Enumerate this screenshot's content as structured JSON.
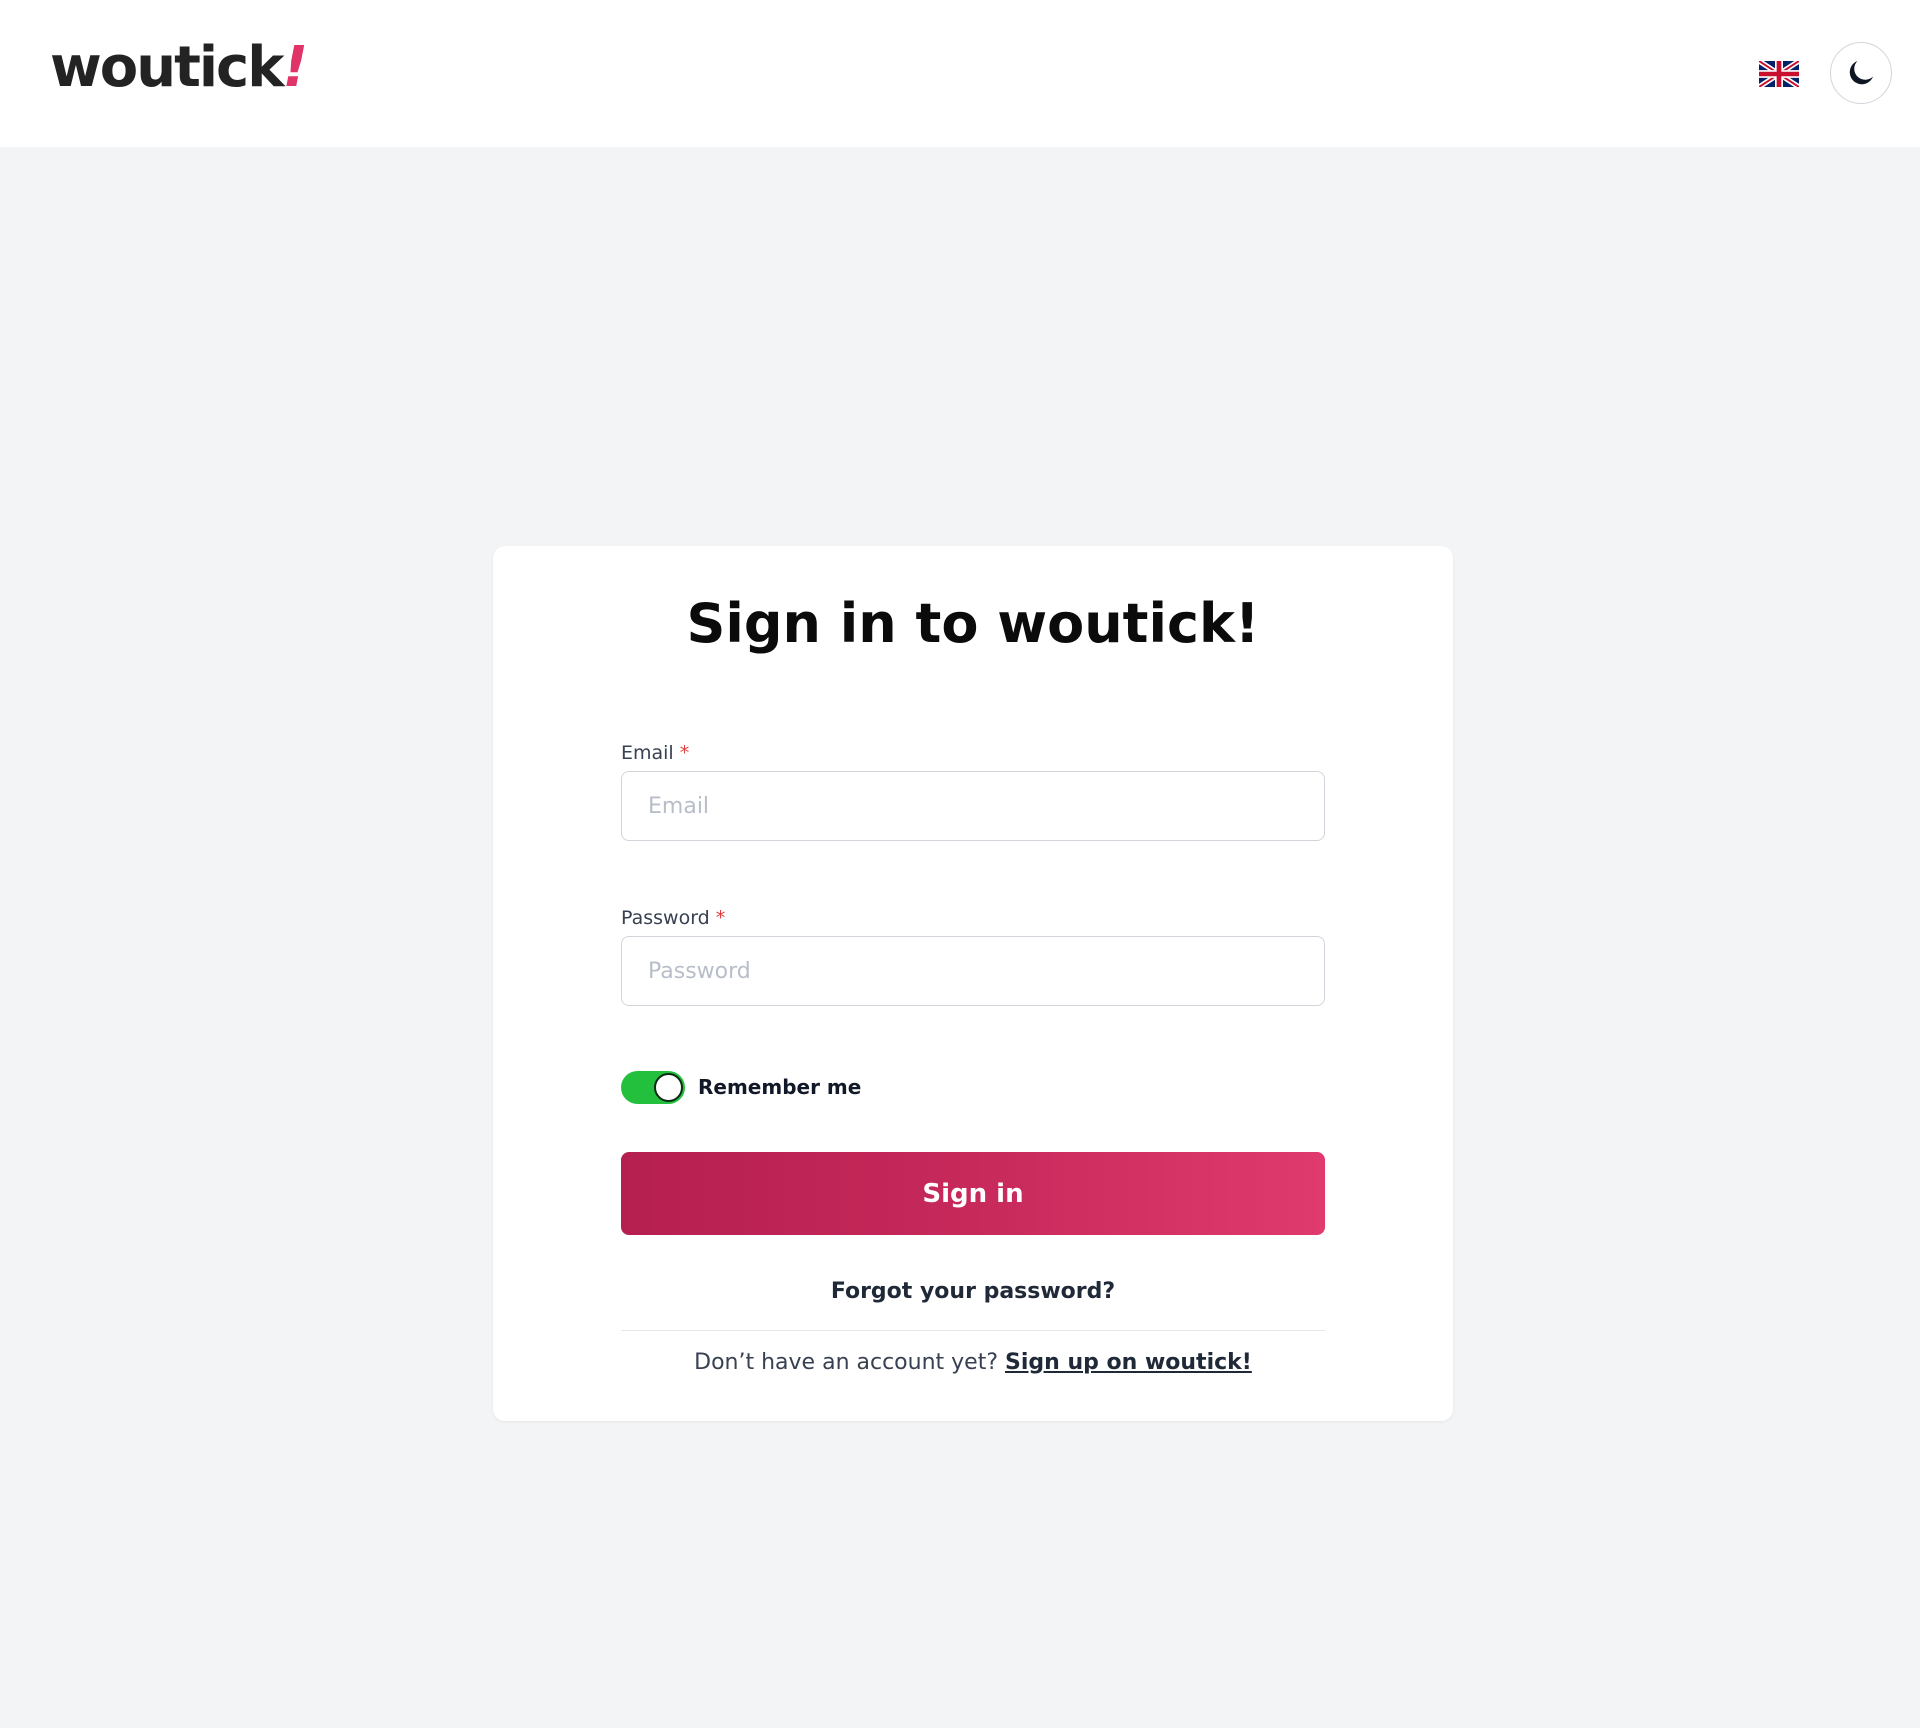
{
  "header": {
    "logo_text": "woutick",
    "logo_mark": "!",
    "language_icon": "uk-flag-icon",
    "theme_icon": "moon-icon"
  },
  "login": {
    "title": "Sign in to woutick!",
    "email_label": "Email",
    "email_placeholder": "Email",
    "email_value": "",
    "password_label": "Password",
    "password_placeholder": "Password",
    "password_value": "",
    "required_marker": "*",
    "remember_label": "Remember me",
    "remember_checked": true,
    "submit_label": "Sign in",
    "forgot_label": "Forgot your password?",
    "no_account_text": "Don’t have an account yet?",
    "signup_link": "Sign up on woutick!"
  },
  "colors": {
    "brand": "#e03468",
    "button_gradient_start": "#b51f50",
    "button_gradient_end": "#e03a6e",
    "toggle_on": "#22c03d",
    "page_background": "#f3f4f6",
    "card_background": "#ffffff"
  }
}
